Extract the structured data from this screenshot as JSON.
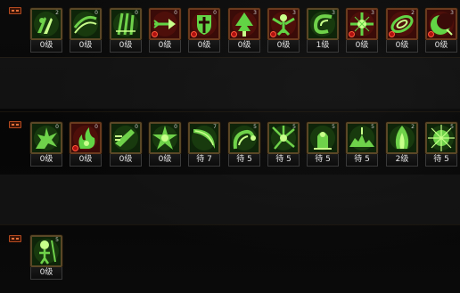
{
  "rows": [
    {
      "slots": [
        {
          "icon": "claw-slash-icon",
          "hotkey": "2",
          "level": "0级",
          "locked": false,
          "variant": "green"
        },
        {
          "icon": "wind-slash-icon",
          "hotkey": "0",
          "level": "0级",
          "locked": false,
          "variant": "green"
        },
        {
          "icon": "triple-claw-icon",
          "hotkey": "0",
          "level": "0级",
          "locked": false,
          "variant": "green"
        },
        {
          "icon": "arrow-icon",
          "hotkey": "0",
          "level": "0级",
          "locked": true,
          "variant": "red"
        },
        {
          "icon": "shield-cross-icon",
          "hotkey": "0",
          "level": "0级",
          "locked": true,
          "variant": "red"
        },
        {
          "icon": "tree-icon",
          "hotkey": "3",
          "level": "0级",
          "locked": true,
          "variant": "red"
        },
        {
          "icon": "winged-figure-icon",
          "hotkey": "3",
          "level": "0级",
          "locked": true,
          "variant": "red"
        },
        {
          "icon": "swirl-icon",
          "hotkey": "3",
          "level": "1级",
          "locked": false,
          "variant": "green"
        },
        {
          "icon": "plus-star-icon",
          "hotkey": "3",
          "level": "0级",
          "locked": true,
          "variant": "red"
        },
        {
          "icon": "cyclone-icon",
          "hotkey": "2",
          "level": "0级",
          "locked": true,
          "variant": "red"
        },
        {
          "icon": "crescent-icon",
          "hotkey": "3",
          "level": "0级",
          "locked": true,
          "variant": "red"
        }
      ]
    },
    {
      "slots": [
        {
          "icon": "burst-icon",
          "hotkey": "0",
          "level": "0级",
          "locked": false,
          "variant": "green"
        },
        {
          "icon": "fire-fist-icon",
          "hotkey": "0",
          "level": "0级",
          "locked": true,
          "variant": "red"
        },
        {
          "icon": "dash-icon",
          "hotkey": "0",
          "level": "0级",
          "locked": false,
          "variant": "green"
        },
        {
          "icon": "star-burst-icon",
          "hotkey": "0",
          "level": "0级",
          "locked": false,
          "variant": "green"
        },
        {
          "icon": "blade-sweep-icon",
          "hotkey": "7",
          "level": "待  7",
          "locked": false,
          "variant": "green"
        },
        {
          "icon": "vine-whip-icon",
          "hotkey": "5",
          "level": "待  5",
          "locked": false,
          "variant": "green"
        },
        {
          "icon": "shatter-icon",
          "hotkey": "5",
          "level": "待  5",
          "locked": false,
          "variant": "green"
        },
        {
          "icon": "spirit-rise-icon",
          "hotkey": "5",
          "level": "待  5",
          "locked": false,
          "variant": "green"
        },
        {
          "icon": "ground-crack-icon",
          "hotkey": "5",
          "level": "待  5",
          "locked": false,
          "variant": "green"
        },
        {
          "icon": "flame-pillar-icon",
          "hotkey": "2",
          "level": "2级",
          "locked": false,
          "variant": "green"
        },
        {
          "icon": "nova-icon",
          "hotkey": "5",
          "level": "待  5",
          "locked": false,
          "variant": "green"
        }
      ]
    },
    {
      "slots": [
        {
          "icon": "skeleton-warrior-icon",
          "hotkey": "5",
          "level": "0级",
          "locked": false,
          "variant": "green"
        }
      ]
    }
  ],
  "colors": {
    "icon_green": "#6fd24a",
    "icon_glow": "#b8ff7a",
    "frame_gold": "#5a4726",
    "locked_red": "#b01010"
  }
}
